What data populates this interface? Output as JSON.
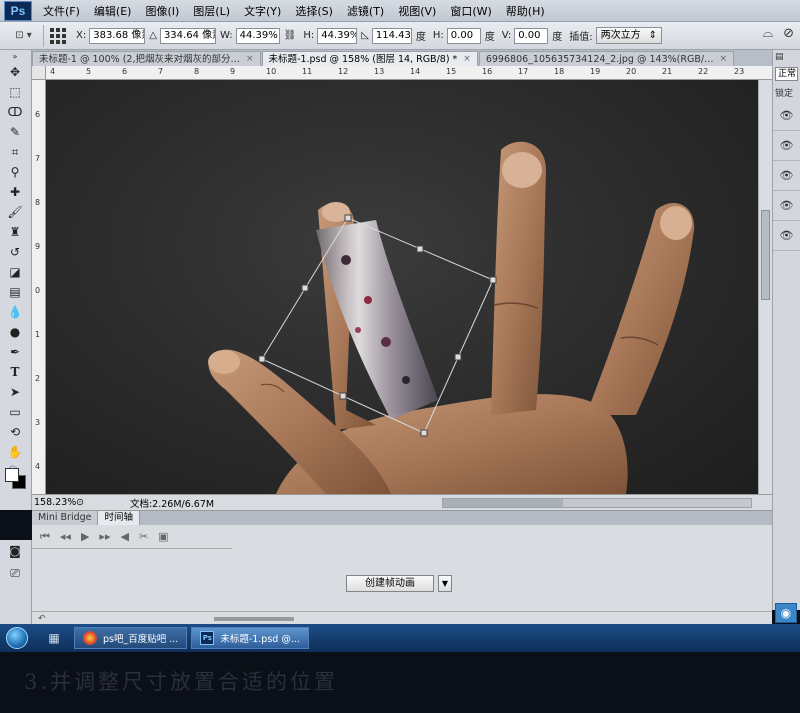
{
  "app": {
    "logo": "Ps",
    "menu": [
      "文件(F)",
      "编辑(E)",
      "图像(I)",
      "图层(L)",
      "文字(Y)",
      "选择(S)",
      "滤镜(T)",
      "视图(V)",
      "窗口(W)",
      "帮助(H)"
    ]
  },
  "options": {
    "x_label": "X:",
    "x_value": "383.68 像素",
    "y_value": "334.64 像素",
    "w_label": "W:",
    "w_value": "44.39%",
    "h_label": "H:",
    "h_value": "44.39%",
    "angle_value": "114.43",
    "angle_unit": "度",
    "hskew_label": "H:",
    "hskew_value": "0.00",
    "hskew_unit": "度",
    "vskew_label": "V:",
    "vskew_value": "0.00",
    "vskew_unit": "度",
    "interp_label": "插值:",
    "interp_value": "两次立方"
  },
  "tabs": [
    {
      "label": "未标题-1 @ 100% (2,把烟灰来对烟灰的部分…",
      "active": false
    },
    {
      "label": "未标题-1.psd @ 158% (图层 14, RGB/8) *",
      "active": true
    },
    {
      "label": "6996806_105635734124_2.jpg @ 143%(RGB/…",
      "active": false
    }
  ],
  "ruler_top": [
    "4",
    "5",
    "6",
    "7",
    "8",
    "9",
    "10",
    "11",
    "12",
    "13",
    "14",
    "15",
    "16",
    "17",
    "18",
    "19",
    "20",
    "21",
    "22",
    "23"
  ],
  "ruler_left": [
    "6",
    "7",
    "8",
    "9",
    "0",
    "1",
    "2",
    "3",
    "4"
  ],
  "status": {
    "zoom": "158.23%",
    "doc": "文档:2.26M/6.67M"
  },
  "right_dock": {
    "mode": "正常",
    "lock": "锁定",
    "eye_count": 5
  },
  "timeline": {
    "tabs": [
      "Mini Bridge",
      "时间轴"
    ],
    "create_button": "创建帧动画"
  },
  "taskbar": {
    "tasks": [
      {
        "label": "ps吧_百度贴吧 ...",
        "icon": "browser-icon",
        "active": false
      },
      {
        "label": "未标题-1.psd @...",
        "icon": "ps-icon",
        "active": true
      }
    ]
  },
  "caption": "3.并调整尺寸放置合适的位置"
}
